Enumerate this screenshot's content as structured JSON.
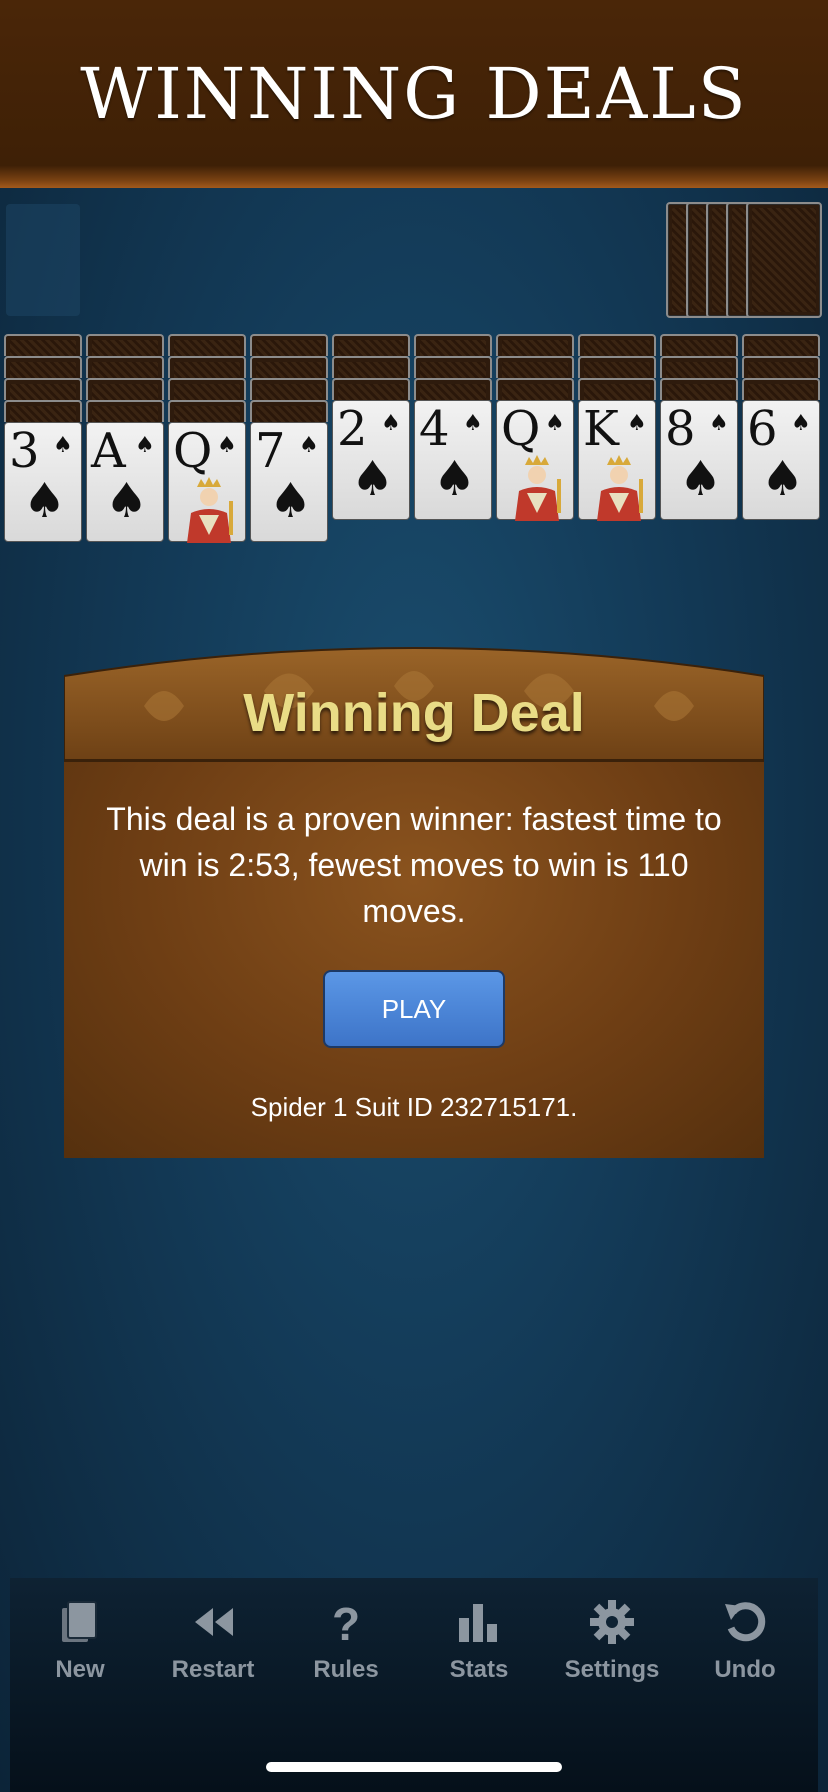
{
  "header": {
    "title": "WINNING DEALS"
  },
  "tableau": [
    {
      "backs": 4,
      "rank": "3",
      "court": false
    },
    {
      "backs": 4,
      "rank": "A",
      "court": false
    },
    {
      "backs": 4,
      "rank": "Q",
      "court": true
    },
    {
      "backs": 4,
      "rank": "7",
      "court": false
    },
    {
      "backs": 3,
      "rank": "2",
      "court": false
    },
    {
      "backs": 3,
      "rank": "4",
      "court": false
    },
    {
      "backs": 3,
      "rank": "Q",
      "court": true
    },
    {
      "backs": 3,
      "rank": "K",
      "court": true
    },
    {
      "backs": 3,
      "rank": "8",
      "court": false
    },
    {
      "backs": 3,
      "rank": "6",
      "court": false
    }
  ],
  "stock": {
    "piles": 5
  },
  "dialog": {
    "title": "Winning Deal",
    "message": "This deal is a proven winner: fastest time to win is 2:53, fewest moves to win is 110 moves.",
    "play_label": "PLAY",
    "deal_id": "Spider 1 Suit ID 232715171."
  },
  "toolbar": {
    "new_label": "New",
    "restart_label": "Restart",
    "rules_label": "Rules",
    "stats_label": "Stats",
    "settings_label": "Settings",
    "undo_label": "Undo"
  },
  "colors": {
    "header_brown": "#3e2006",
    "felt_blue": "#133a57",
    "title_gold": "#e9dc86",
    "play_blue": "#4a83d6",
    "toolbar_icon": "#8c96a0"
  }
}
